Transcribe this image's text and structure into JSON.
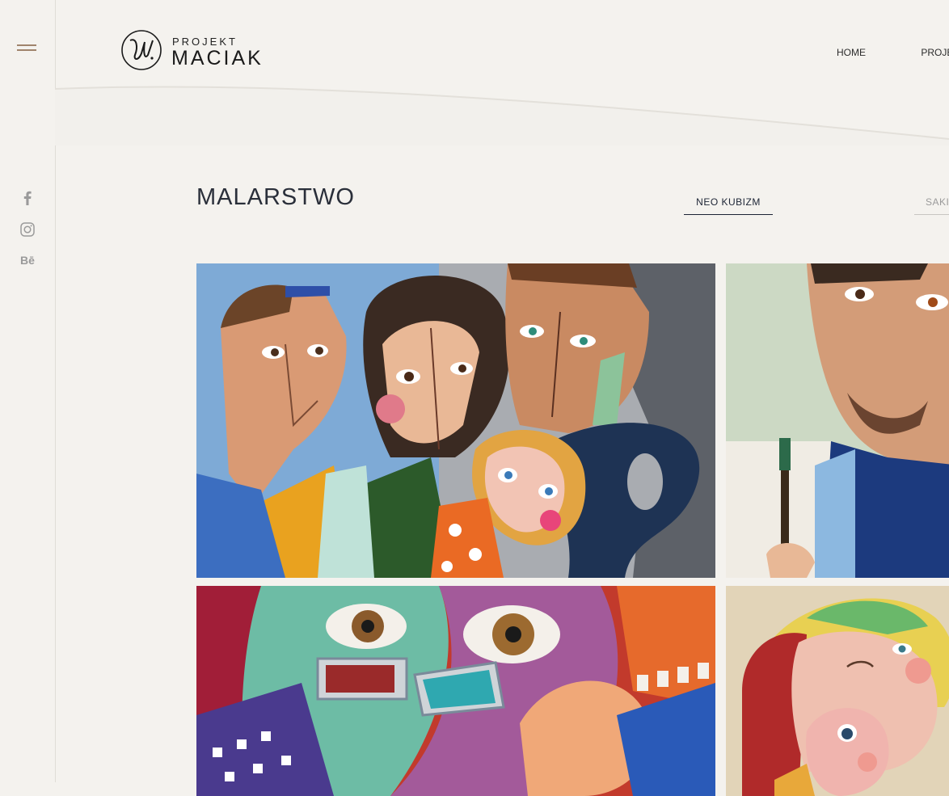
{
  "brand": {
    "small": "PROJEKT",
    "big": "MACIAK"
  },
  "nav": {
    "items": [
      "HOME",
      "PROJEK"
    ]
  },
  "page": {
    "title": "MALARSTWO"
  },
  "filters": {
    "active": "NEO KUBIZM",
    "next": "SAKI"
  },
  "social": {
    "behance": "Bē"
  },
  "colors": {
    "accent": "#a0846c",
    "background": "#f4f2ee",
    "text": "#2a2f3a"
  }
}
